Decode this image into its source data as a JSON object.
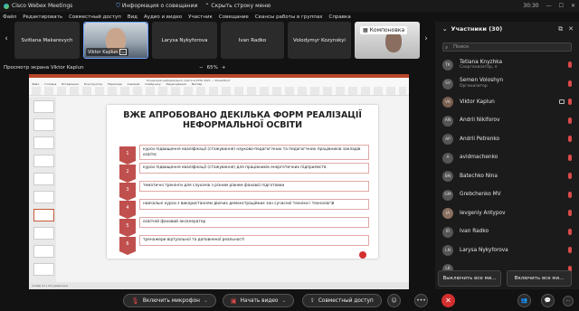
{
  "window": {
    "app_name": "Cisco Webex Meetings",
    "meeting_info": "Информация о совещании",
    "hide_menu": "Скрыть строку меню",
    "time": "30:30"
  },
  "menu": [
    "Файл",
    "Редактировать",
    "Совместный доступ",
    "Вид",
    "Аудио и видео",
    "Участник",
    "Совещание",
    "Сеансы работы в группах",
    "Справка"
  ],
  "tiles": [
    {
      "name": "Svitlana Makarevych",
      "video": false
    },
    {
      "name": "Viktor Kaplun",
      "video": true
    },
    {
      "name": "Larysa Nykyforova",
      "video": false
    },
    {
      "name": "Ivan Radko",
      "video": false
    },
    {
      "name": "Volodymyr Kozynskyi",
      "video": false
    },
    {
      "name": "",
      "video": true,
      "label": "Компоновка"
    }
  ],
  "share": {
    "title": "Просмотр экрана Viktor Kaplun",
    "zoom": "65%",
    "minus": "−",
    "plus": "+"
  },
  "pp": {
    "file_title": "Концепція неформальної освіти в ІППО 2021 — PowerPoint",
    "tabs": [
      "Файл",
      "Головна",
      "Вставлення",
      "Конструктор",
      "Переходи",
      "Анімація",
      "Слайд-шоу",
      "Рецензування",
      "Вигляд"
    ],
    "status": "Слайд 14 з 24   українська"
  },
  "slide": {
    "title_line1": "ВЖЕ АПРОБОВАНО ДЕКІЛЬКА ФОРМ РЕАЛІЗАЦІЇ",
    "title_line2": "НЕФОРМАЛЬНОЇ ОСВІТИ",
    "items": [
      "курси підвищення кваліфікації (стажування) науково-педагогічних та педагогічних працівників закладів освіти;",
      "курси підвищення кваліфікації (стажування) для працівників енергетичних підприємств",
      "тематичні тренінги для слухачів з різним рівнем фахової підготовки",
      "навчальні курси з використанням діючих демонстраційних зон сучасної техніки і технологій",
      "освітній фаховий акселератор",
      "тренажери віртуальної та доповненої реальності"
    ],
    "numbers": [
      "1",
      "2",
      "3",
      "4",
      "5",
      "6"
    ]
  },
  "panel": {
    "title": "Участники (30)",
    "search_placeholder": "Поиск",
    "participants": [
      {
        "initials": "TK",
        "name": "Tetiana Knyzhka",
        "role": "Соорганизатор, я"
      },
      {
        "initials": "SV",
        "name": "Semen Voloshyn",
        "role": "Организатор"
      },
      {
        "initials": "VK",
        "name": "Viktor Kaplun",
        "role": ""
      },
      {
        "initials": "AN",
        "name": "Andrii Nikiforov",
        "role": ""
      },
      {
        "initials": "AP",
        "name": "Andrii Petrenko",
        "role": ""
      },
      {
        "initials": "A",
        "name": "avidmachenko",
        "role": ""
      },
      {
        "initials": "BN",
        "name": "Batechko Nina",
        "role": ""
      },
      {
        "initials": "GM",
        "name": "Grebchenko MV",
        "role": ""
      },
      {
        "initials": "IA",
        "name": "Ievgeniy Antypov",
        "role": ""
      },
      {
        "initials": "IR",
        "name": "Ivan Radko",
        "role": ""
      },
      {
        "initials": "LN",
        "name": "Larysa Nykyforova",
        "role": ""
      },
      {
        "initials": "LK",
        "name": "",
        "role": ""
      }
    ],
    "mute_all": "Выключить все ми...",
    "unmute_all": "Включить все ми..."
  },
  "controls": {
    "mic": "Включить микрофон",
    "video": "Начать видео",
    "share": "Совместный доступ",
    "more": "•••",
    "end": "✕"
  }
}
